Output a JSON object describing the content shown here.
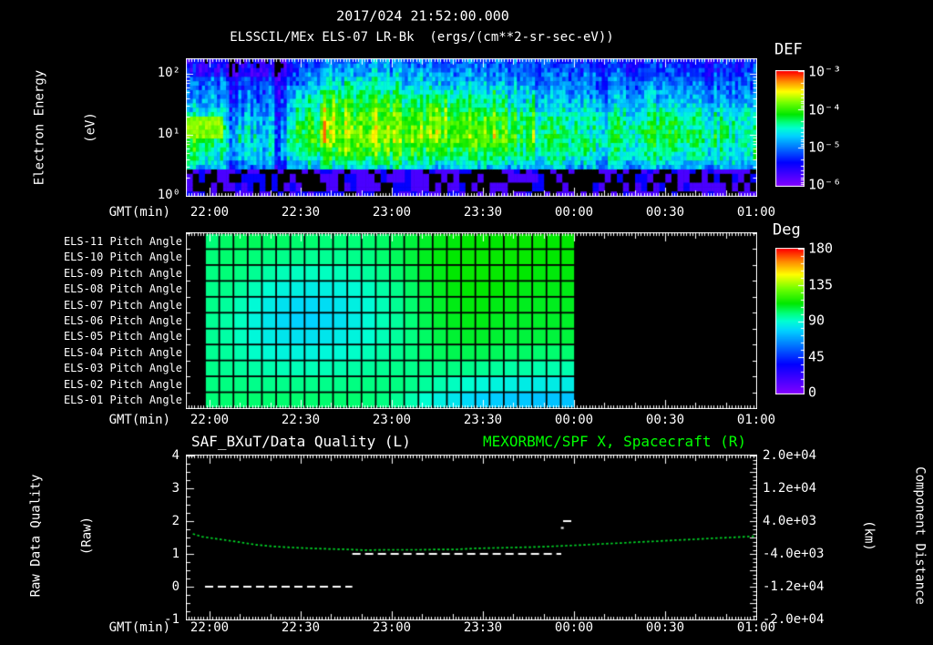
{
  "header": {
    "title": "2017/024 21:52:00.000",
    "subtitle": "ELSSCIL/MEx ELS-07 LR-Bk  (ergs/(cm**2-sr-sec-eV))"
  },
  "time_axis": {
    "label": "GMT(min)",
    "tick_labels": [
      "22:00",
      "22:30",
      "23:00",
      "23:30",
      "00:00",
      "00:30",
      "01:00"
    ]
  },
  "spectrogram": {
    "ylabel_line1": "Electron Energy",
    "ylabel_line2": "(eV)",
    "ytick_labels": [
      "10²",
      "10¹",
      "10⁰"
    ],
    "colorbar": {
      "title": "DEF",
      "tick_labels": [
        "10⁻³",
        "10⁻⁴",
        "10⁻⁵",
        "10⁻⁶"
      ]
    }
  },
  "pitch_panel": {
    "row_labels": [
      "ELS-11 Pitch Angle",
      "ELS-10 Pitch Angle",
      "ELS-09 Pitch Angle",
      "ELS-08 Pitch Angle",
      "ELS-07 Pitch Angle",
      "ELS-06 Pitch Angle",
      "ELS-05 Pitch Angle",
      "ELS-04 Pitch Angle",
      "ELS-03 Pitch Angle",
      "ELS-02 Pitch Angle",
      "ELS-01 Pitch Angle"
    ],
    "colorbar": {
      "title": "Deg",
      "tick_labels": [
        "180",
        "135",
        "90",
        "45",
        "0"
      ]
    }
  },
  "bottom_panel": {
    "title_left": "SAF_BXuT/Data Quality (L)",
    "title_right": "MEXORBMC/SPF X, Spacecraft (R)",
    "ylabel_left_line1": "Raw Data Quality",
    "ylabel_left_line2": "(Raw)",
    "ylabel_right_line1": "Component Distance",
    "ylabel_right_line2": "(km)",
    "ytick_labels_left": [
      "4",
      "3",
      "2",
      "1",
      "0",
      "-1"
    ],
    "ytick_labels_right": [
      "2.0e+04",
      "1.2e+04",
      "4.0e+03",
      "-4.0e+03",
      "-1.2e+04",
      "-2.0e+04"
    ]
  },
  "colors": {
    "background": "#000000",
    "text": "#ffffff",
    "accent_green": "#00ff00",
    "curve_green": "#00dc28"
  },
  "chart_data": [
    {
      "type": "heatmap",
      "name": "electron_energy_spectrogram",
      "title": "ELSSCIL/MEx ELS-07 LR-Bk",
      "units": "ergs/(cm**2-sr-sec-eV)",
      "xlabel": "GMT(min)",
      "ylabel": "Electron Energy (eV)",
      "y_scale": "log",
      "y_range_ev": [
        1,
        174
      ],
      "colorbar_label": "DEF",
      "colorbar_range_log10": [
        -6,
        -3
      ],
      "x_start": "21:52",
      "x_end": "01:00",
      "time_bin_minutes": 10,
      "energy_rows_log10_ev": [
        2.15,
        1.9,
        1.65,
        1.4,
        1.15,
        0.9,
        0.55,
        0.15
      ],
      "grid": [
        [
          -5.3,
          -5.3,
          -5.3,
          -5.3,
          -5.2,
          -5.0,
          -5.0,
          -5.0,
          -5.1,
          -5.1,
          -5.1,
          -5.2,
          -5.3,
          -5.3,
          -5.3,
          -5.3,
          -5.3,
          -5.3,
          -5.3
        ],
        [
          -5.1,
          -5.1,
          -5.1,
          -5.2,
          -4.9,
          -4.6,
          -4.6,
          -4.7,
          -4.8,
          -4.8,
          -4.8,
          -5.0,
          -5.1,
          -5.1,
          -5.1,
          -5.1,
          -5.0,
          -5.1,
          -5.1
        ],
        [
          -4.9,
          -4.9,
          -5.0,
          -5.0,
          -4.5,
          -4.2,
          -4.2,
          -4.3,
          -4.4,
          -4.4,
          -4.4,
          -4.7,
          -4.9,
          -4.9,
          -4.9,
          -4.8,
          -4.7,
          -4.8,
          -4.9
        ],
        [
          -4.6,
          -4.6,
          -4.7,
          -4.8,
          -4.2,
          -3.9,
          -3.9,
          -4.0,
          -4.0,
          -4.0,
          -4.0,
          -4.3,
          -4.5,
          -4.5,
          -4.5,
          -4.4,
          -4.3,
          -4.4,
          -4.5
        ],
        [
          -4.0,
          -4.4,
          -4.5,
          -4.6,
          -4.0,
          -3.8,
          -3.8,
          -3.8,
          -3.9,
          -3.9,
          -3.9,
          -4.2,
          -4.3,
          -4.4,
          -4.4,
          -4.3,
          -4.1,
          -4.3,
          -4.4
        ],
        [
          -4.3,
          -4.5,
          -4.6,
          -4.7,
          -4.3,
          -4.1,
          -4.1,
          -4.1,
          -4.2,
          -4.2,
          -4.2,
          -4.4,
          -4.5,
          -4.5,
          -4.5,
          -4.5,
          -4.4,
          -4.5,
          -4.5
        ],
        [
          -5.0,
          -5.1,
          -5.1,
          -5.2,
          -5.0,
          -4.9,
          -4.9,
          -4.9,
          -5.0,
          -5.0,
          -5.0,
          -5.1,
          -5.1,
          -5.1,
          -5.1,
          -5.1,
          -5.1,
          -5.1,
          -5.1
        ],
        [
          -5.8,
          -5.8,
          -5.8,
          -5.8,
          -5.8,
          -5.8,
          -5.8,
          -5.8,
          -5.8,
          -5.8,
          -5.8,
          -5.8,
          -5.8,
          -5.8,
          -5.8,
          -5.8,
          -5.8,
          -5.8,
          -5.8
        ]
      ]
    },
    {
      "type": "heatmap",
      "name": "pitch_angle_panels",
      "rows": [
        "ELS-11",
        "ELS-10",
        "ELS-09",
        "ELS-08",
        "ELS-07",
        "ELS-06",
        "ELS-05",
        "ELS-04",
        "ELS-03",
        "ELS-02",
        "ELS-01"
      ],
      "colorbar_label": "Deg",
      "value_range": [
        0,
        180
      ],
      "x_start": "21:58",
      "x_end": "00:00",
      "values": [
        [
          100,
          102,
          103,
          103,
          102,
          102,
          101,
          101,
          100,
          100,
          100,
          101,
          102,
          104,
          106,
          108,
          110,
          111,
          112,
          112,
          112,
          113,
          113,
          113,
          112,
          112
        ],
        [
          100,
          101,
          101,
          100,
          99,
          98,
          98,
          97,
          97,
          97,
          98,
          99,
          101,
          103,
          106,
          109,
          111,
          112,
          113,
          113,
          113,
          113,
          113,
          112,
          112,
          112
        ],
        [
          99,
          100,
          99,
          97,
          95,
          93,
          92,
          92,
          92,
          93,
          94,
          96,
          98,
          101,
          104,
          108,
          110,
          112,
          113,
          113,
          113,
          112,
          112,
          111,
          111,
          111
        ],
        [
          98,
          98,
          96,
          93,
          90,
          87,
          86,
          85,
          86,
          87,
          89,
          92,
          95,
          98,
          102,
          106,
          109,
          111,
          112,
          112,
          112,
          111,
          110,
          110,
          110,
          110
        ],
        [
          98,
          96,
          93,
          89,
          85,
          82,
          80,
          80,
          81,
          83,
          86,
          89,
          93,
          97,
          101,
          105,
          108,
          110,
          111,
          111,
          110,
          110,
          109,
          109,
          109,
          109
        ],
        [
          97,
          95,
          92,
          87,
          83,
          80,
          78,
          78,
          80,
          82,
          85,
          89,
          93,
          96,
          100,
          104,
          107,
          109,
          110,
          110,
          109,
          108,
          108,
          108,
          108,
          108
        ],
        [
          97,
          95,
          92,
          88,
          85,
          83,
          82,
          82,
          83,
          85,
          87,
          90,
          93,
          96,
          99,
          102,
          105,
          107,
          108,
          108,
          107,
          106,
          106,
          106,
          106,
          106
        ],
        [
          97,
          96,
          94,
          91,
          89,
          87,
          87,
          87,
          88,
          89,
          91,
          93,
          95,
          97,
          99,
          101,
          103,
          104,
          104,
          104,
          103,
          102,
          102,
          101,
          101,
          101
        ],
        [
          98,
          97,
          96,
          95,
          94,
          93,
          93,
          93,
          93,
          94,
          95,
          96,
          97,
          98,
          98,
          99,
          99,
          99,
          98,
          97,
          96,
          95,
          95,
          94,
          94,
          94
        ],
        [
          99,
          99,
          99,
          98,
          98,
          98,
          98,
          98,
          98,
          98,
          99,
          99,
          99,
          99,
          98,
          96,
          94,
          92,
          90,
          88,
          87,
          86,
          85,
          85,
          85,
          85
        ],
        [
          100,
          101,
          101,
          101,
          101,
          101,
          101,
          101,
          101,
          101,
          101,
          100,
          99,
          97,
          94,
          90,
          86,
          83,
          80,
          78,
          77,
          76,
          76,
          75,
          75,
          75
        ]
      ]
    },
    {
      "type": "line",
      "name": "quality_and_spacecraft_x",
      "title_left": "SAF_BXuT/Data Quality (L)",
      "title_right": "MEXORBMC/SPF X, Spacecraft (R)",
      "ylim_left": [
        -1,
        4
      ],
      "ylim_right": [
        -20000,
        20000
      ],
      "x_start": "21:52",
      "x_end": "01:00",
      "spacecraft_x_km": {
        "x_min": [
          2,
          5,
          11,
          17,
          23,
          29,
          35,
          41,
          47,
          53,
          59,
          65,
          71,
          77,
          83,
          89,
          95,
          101,
          107,
          113,
          119,
          125,
          131,
          137,
          143,
          149,
          155,
          161,
          167,
          173,
          179,
          184,
          188
        ],
        "km": [
          900,
          200,
          -450,
          -1100,
          -1800,
          -2200,
          -2450,
          -2650,
          -2800,
          -2900,
          -3100,
          -3000,
          -3000,
          -3000,
          -2900,
          -2900,
          -2650,
          -2550,
          -2450,
          -2350,
          -2200,
          -2000,
          -1800,
          -1550,
          -1350,
          -1100,
          -900,
          -650,
          -450,
          -200,
          0,
          200,
          350
        ]
      },
      "data_quality_segments": [
        {
          "start_min": 6,
          "end_min": 54.5,
          "value": 0
        },
        {
          "start_min": 54.5,
          "end_min": 123.3,
          "value": 1
        },
        {
          "start_min": 123.9,
          "end_min": 127.6,
          "value": 2
        }
      ],
      "artifact_point": {
        "min": 123.2,
        "value": 1.82
      }
    }
  ]
}
